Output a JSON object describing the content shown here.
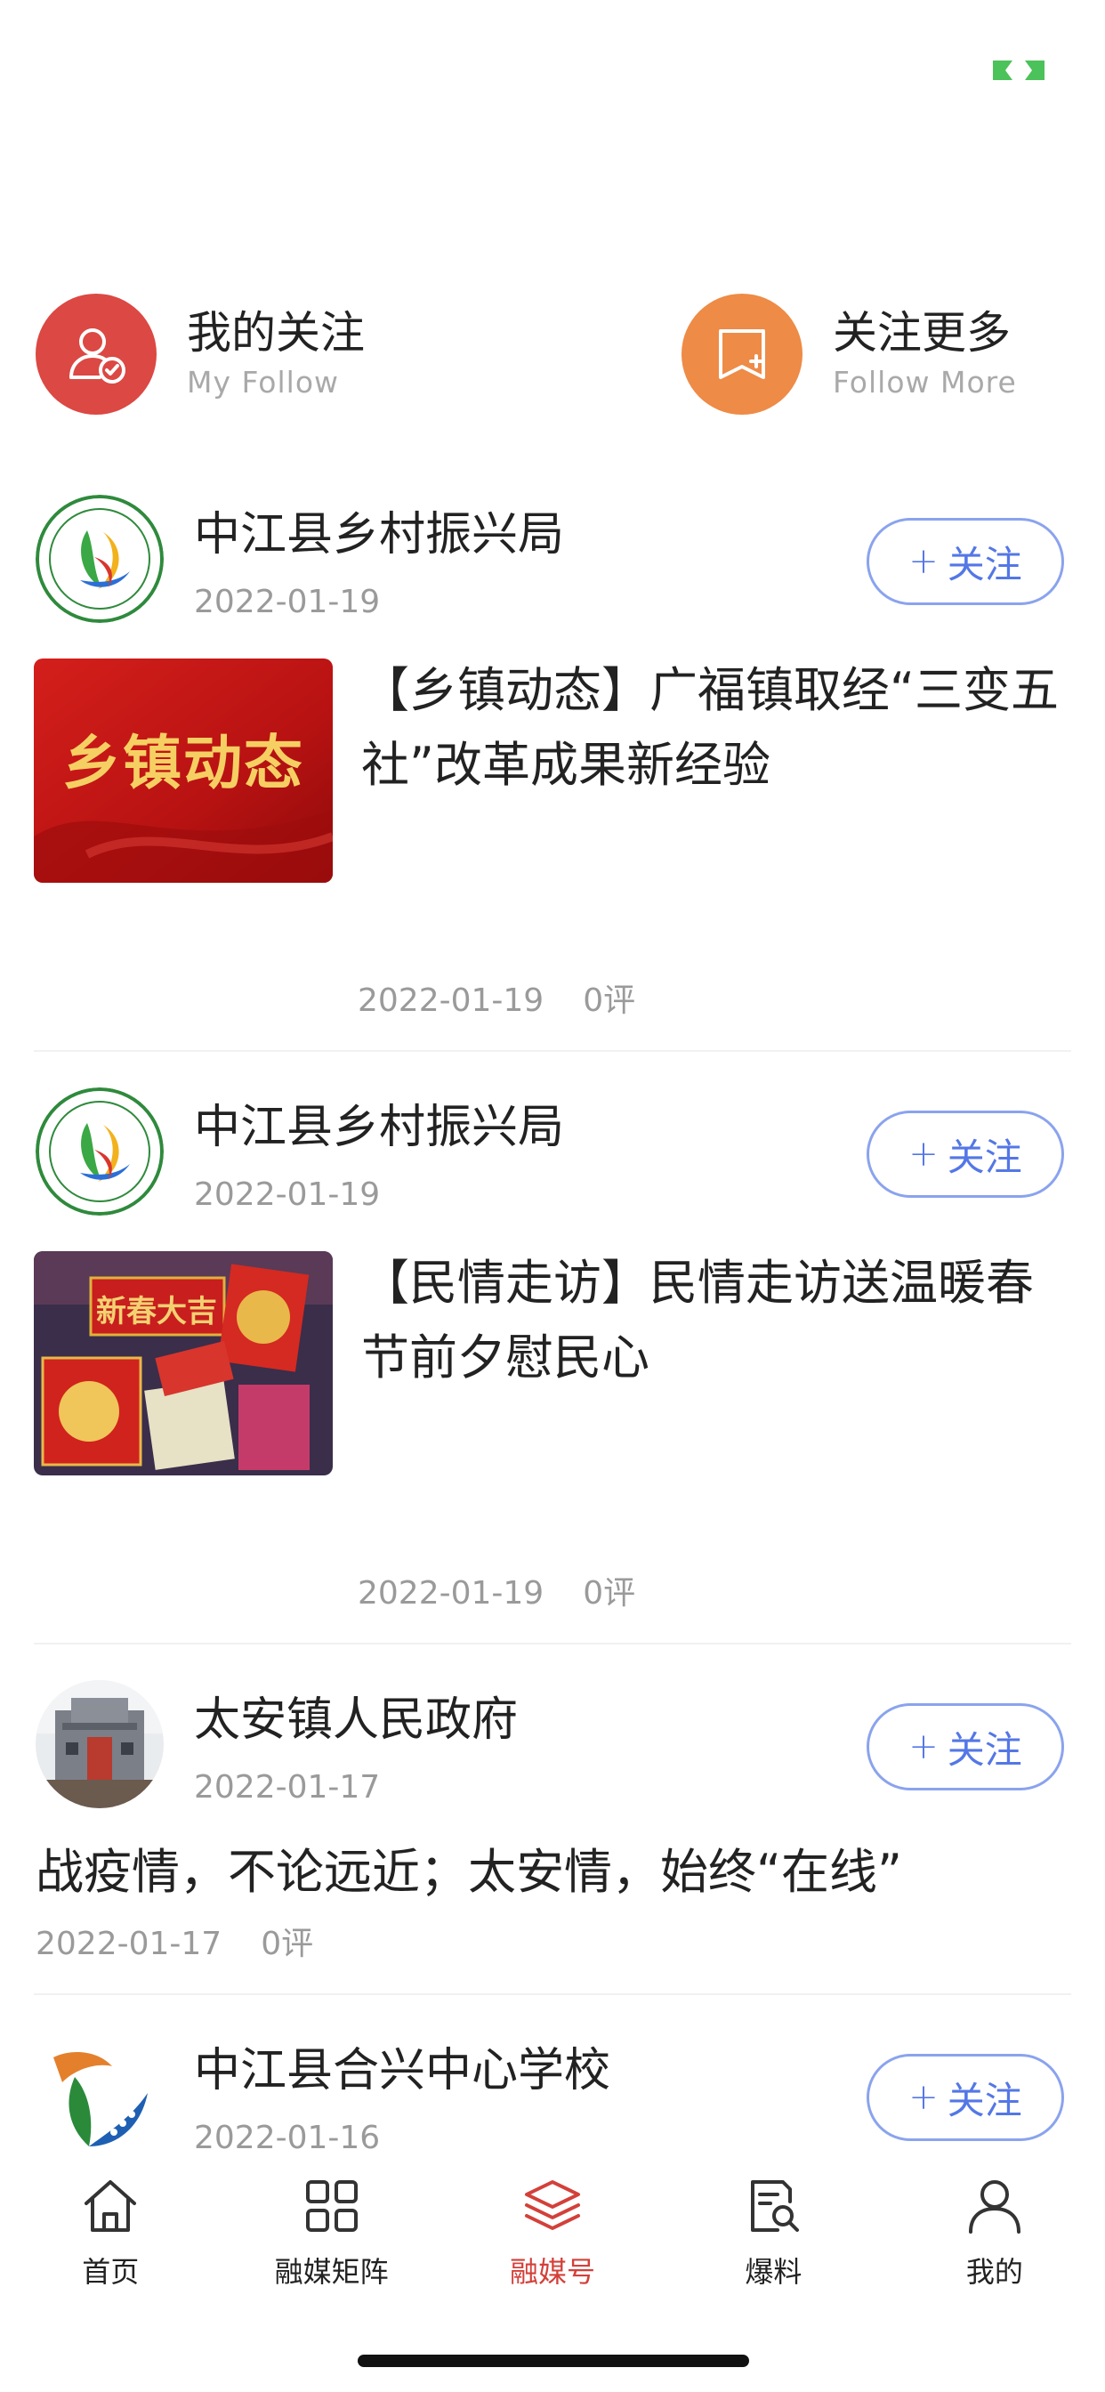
{
  "quick": [
    {
      "title": "我的关注",
      "subtitle": "My Follow",
      "icon": "user-check-icon",
      "color": "#dc4843"
    },
    {
      "title": "关注更多",
      "subtitle": "Follow  More",
      "icon": "bookmark-plus-icon",
      "color": "#ee8b46"
    }
  ],
  "feed": [
    {
      "account": "中江县乡村振兴局",
      "account_date": "2022-01-19",
      "follow_label": "关注",
      "thumb_text": "乡镇动态",
      "title": "【乡镇动态】广福镇取经“三变五社”改革成果新经验",
      "date": "2022-01-19",
      "comments": "0评"
    },
    {
      "account": "中江县乡村振兴局",
      "account_date": "2022-01-19",
      "follow_label": "关注",
      "thumb_text": "新春大吉",
      "title": "【民情走访】民情走访送温暖春节前夕慰民心",
      "date": "2022-01-19",
      "comments": "0评"
    },
    {
      "account": "太安镇人民政府",
      "account_date": "2022-01-17",
      "follow_label": "关注",
      "title": "战疫情，不论远近；太安情，始终“在线”",
      "date": "2022-01-17",
      "comments": "0评"
    },
    {
      "account": "中江县合兴中心学校",
      "account_date": "2022-01-16",
      "follow_label": "关注"
    }
  ],
  "tabs": [
    {
      "label": "首页",
      "icon": "home-icon"
    },
    {
      "label": "融媒矩阵",
      "icon": "grid-icon"
    },
    {
      "label": "融媒号",
      "icon": "layers-icon"
    },
    {
      "label": "爆料",
      "icon": "report-search-icon"
    },
    {
      "label": "我的",
      "icon": "person-icon"
    }
  ],
  "active_tab": "融媒号",
  "colors": {
    "accent": "#d3403a",
    "follow": "#5477e6",
    "badge": "#4cc25a"
  }
}
